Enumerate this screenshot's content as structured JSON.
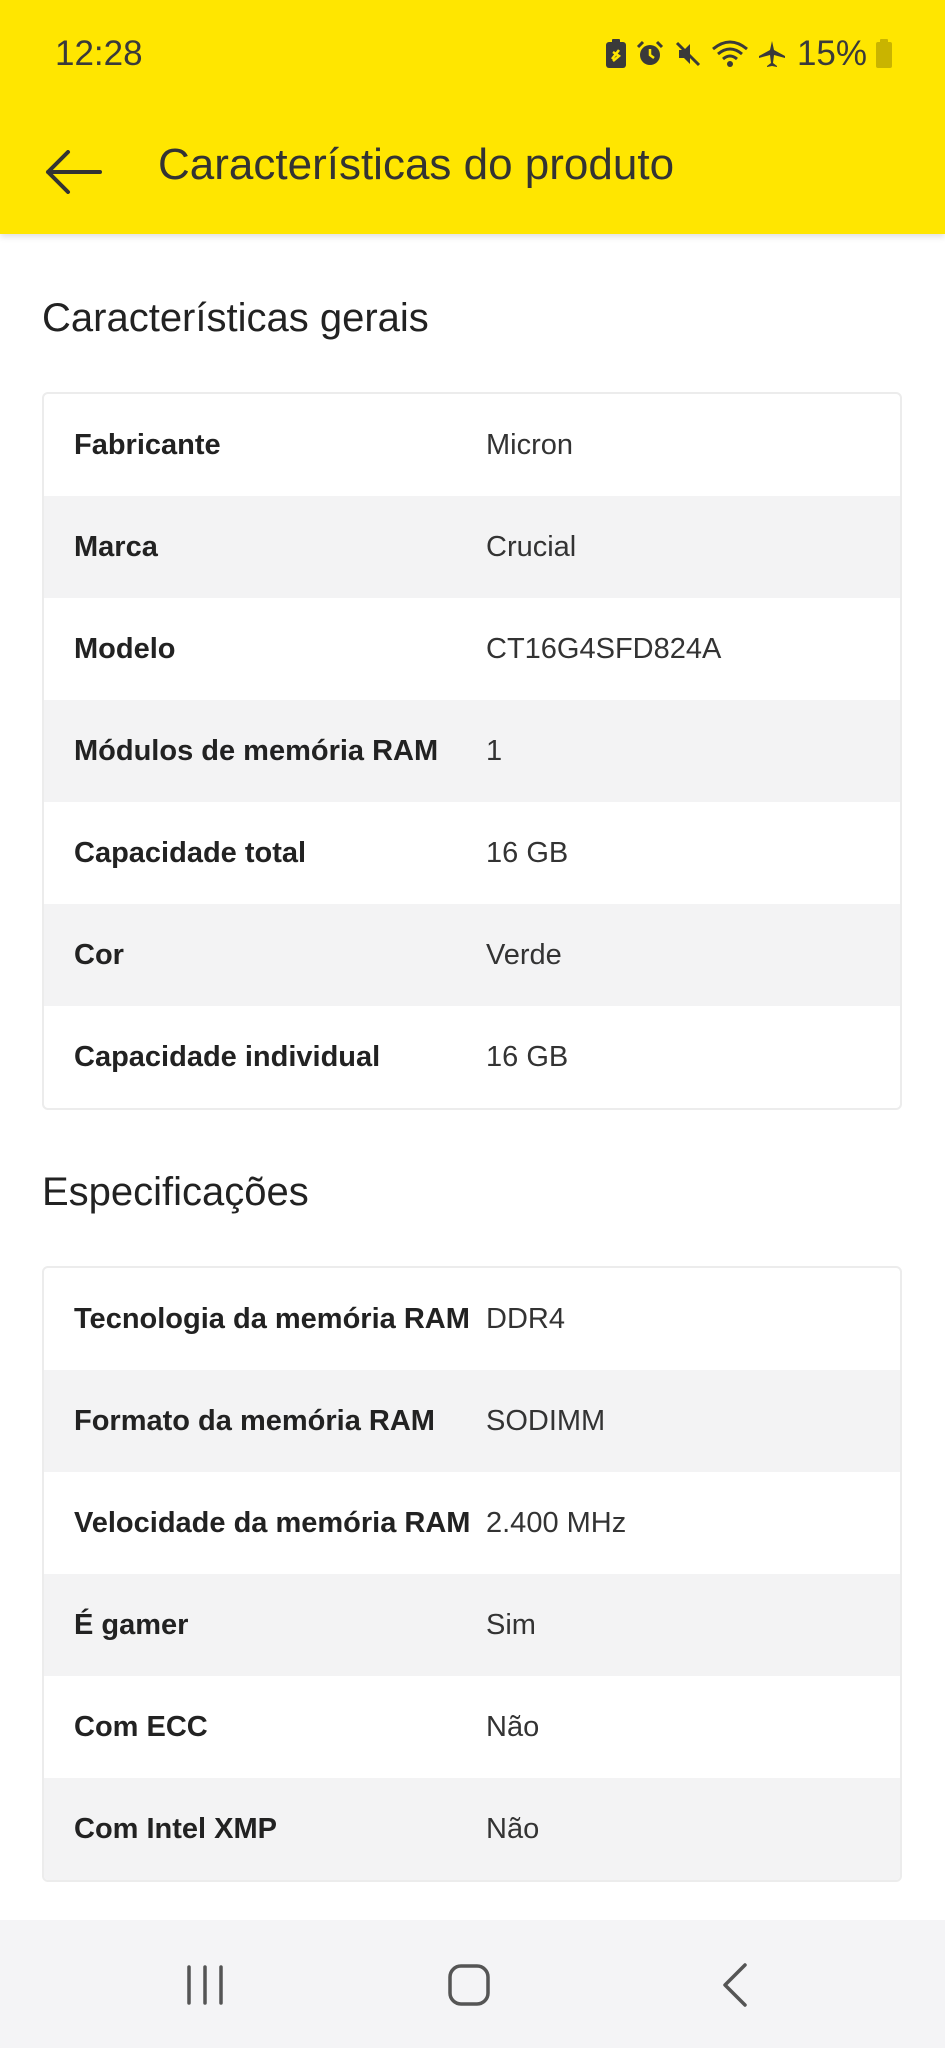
{
  "status_bar": {
    "time": "12:28",
    "battery_percent": "15%",
    "icons": [
      "battery-saver-icon",
      "alarm-icon",
      "mute-icon",
      "wifi-icon",
      "airplane-icon",
      "battery-icon"
    ]
  },
  "toolbar": {
    "back_icon": "arrow-left-icon",
    "title": "Características do produto"
  },
  "colors": {
    "accent": "#ffe600",
    "row_alt": "#f3f3f4",
    "nav_bar": "#f4f4f6"
  },
  "sections": [
    {
      "title": "Características gerais",
      "rows": [
        {
          "label": "Fabricante",
          "value": "Micron"
        },
        {
          "label": "Marca",
          "value": "Crucial"
        },
        {
          "label": "Modelo",
          "value": "CT16G4SFD824A"
        },
        {
          "label": "Módulos de memória RAM",
          "value": "1"
        },
        {
          "label": "Capacidade total",
          "value": "16 GB"
        },
        {
          "label": "Cor",
          "value": "Verde"
        },
        {
          "label": "Capacidade individual",
          "value": "16 GB"
        }
      ]
    },
    {
      "title": "Especificações",
      "rows": [
        {
          "label": "Tecnologia da memória RAM",
          "value": "DDR4"
        },
        {
          "label": "Formato da memória RAM",
          "value": "SODIMM"
        },
        {
          "label": "Velocidade da memória RAM",
          "value": "2.400 MHz"
        },
        {
          "label": "É gamer",
          "value": "Sim"
        },
        {
          "label": "Com ECC",
          "value": "Não"
        },
        {
          "label": "Com Intel XMP",
          "value": "Não"
        }
      ]
    }
  ],
  "nav_bar": {
    "buttons": [
      "recent-apps-icon",
      "home-icon",
      "back-icon"
    ]
  }
}
